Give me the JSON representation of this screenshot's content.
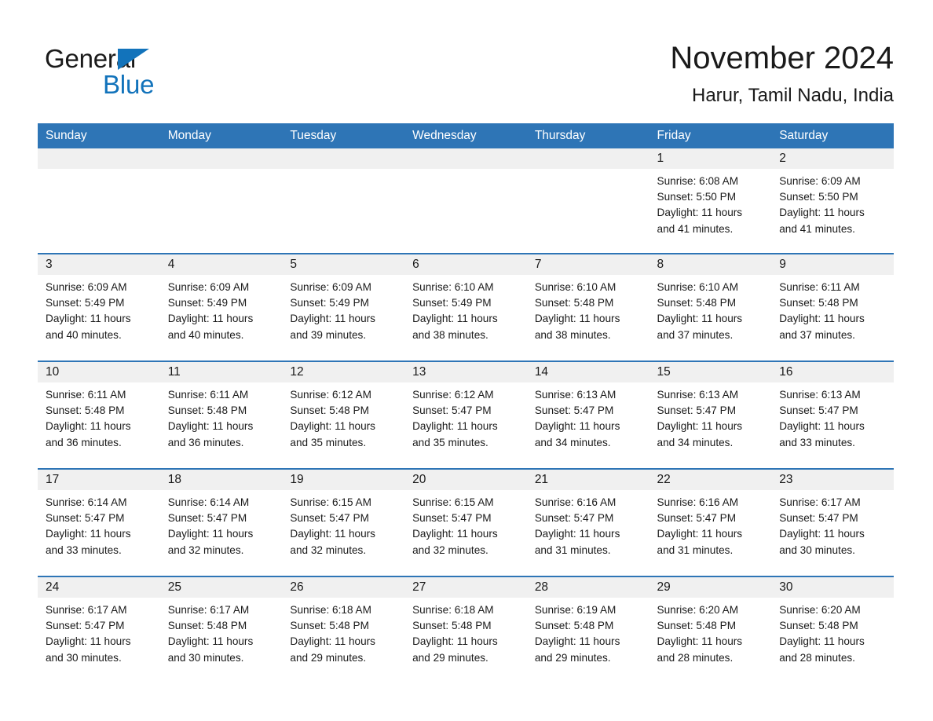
{
  "logo": {
    "word_one": "General",
    "word_two": "Blue",
    "triangle_color": "#1273bb",
    "word_two_color": "#1273bb"
  },
  "header": {
    "title": "November 2024",
    "subtitle": "Harur, Tamil Nadu, India"
  },
  "colors": {
    "header_blue": "#2e75b6",
    "day_band_gray": "#f0f0f0",
    "row_divider_blue": "#2e75b6",
    "text": "#1a1a1a"
  },
  "weekdays": [
    "Sunday",
    "Monday",
    "Tuesday",
    "Wednesday",
    "Thursday",
    "Friday",
    "Saturday"
  ],
  "weeks": [
    [
      {
        "day": "",
        "sunrise": "",
        "sunset": "",
        "daylight_line1": "",
        "daylight_line2": ""
      },
      {
        "day": "",
        "sunrise": "",
        "sunset": "",
        "daylight_line1": "",
        "daylight_line2": ""
      },
      {
        "day": "",
        "sunrise": "",
        "sunset": "",
        "daylight_line1": "",
        "daylight_line2": ""
      },
      {
        "day": "",
        "sunrise": "",
        "sunset": "",
        "daylight_line1": "",
        "daylight_line2": ""
      },
      {
        "day": "",
        "sunrise": "",
        "sunset": "",
        "daylight_line1": "",
        "daylight_line2": ""
      },
      {
        "day": "1",
        "sunrise": "Sunrise: 6:08 AM",
        "sunset": "Sunset: 5:50 PM",
        "daylight_line1": "Daylight: 11 hours",
        "daylight_line2": "and 41 minutes."
      },
      {
        "day": "2",
        "sunrise": "Sunrise: 6:09 AM",
        "sunset": "Sunset: 5:50 PM",
        "daylight_line1": "Daylight: 11 hours",
        "daylight_line2": "and 41 minutes."
      }
    ],
    [
      {
        "day": "3",
        "sunrise": "Sunrise: 6:09 AM",
        "sunset": "Sunset: 5:49 PM",
        "daylight_line1": "Daylight: 11 hours",
        "daylight_line2": "and 40 minutes."
      },
      {
        "day": "4",
        "sunrise": "Sunrise: 6:09 AM",
        "sunset": "Sunset: 5:49 PM",
        "daylight_line1": "Daylight: 11 hours",
        "daylight_line2": "and 40 minutes."
      },
      {
        "day": "5",
        "sunrise": "Sunrise: 6:09 AM",
        "sunset": "Sunset: 5:49 PM",
        "daylight_line1": "Daylight: 11 hours",
        "daylight_line2": "and 39 minutes."
      },
      {
        "day": "6",
        "sunrise": "Sunrise: 6:10 AM",
        "sunset": "Sunset: 5:49 PM",
        "daylight_line1": "Daylight: 11 hours",
        "daylight_line2": "and 38 minutes."
      },
      {
        "day": "7",
        "sunrise": "Sunrise: 6:10 AM",
        "sunset": "Sunset: 5:48 PM",
        "daylight_line1": "Daylight: 11 hours",
        "daylight_line2": "and 38 minutes."
      },
      {
        "day": "8",
        "sunrise": "Sunrise: 6:10 AM",
        "sunset": "Sunset: 5:48 PM",
        "daylight_line1": "Daylight: 11 hours",
        "daylight_line2": "and 37 minutes."
      },
      {
        "day": "9",
        "sunrise": "Sunrise: 6:11 AM",
        "sunset": "Sunset: 5:48 PM",
        "daylight_line1": "Daylight: 11 hours",
        "daylight_line2": "and 37 minutes."
      }
    ],
    [
      {
        "day": "10",
        "sunrise": "Sunrise: 6:11 AM",
        "sunset": "Sunset: 5:48 PM",
        "daylight_line1": "Daylight: 11 hours",
        "daylight_line2": "and 36 minutes."
      },
      {
        "day": "11",
        "sunrise": "Sunrise: 6:11 AM",
        "sunset": "Sunset: 5:48 PM",
        "daylight_line1": "Daylight: 11 hours",
        "daylight_line2": "and 36 minutes."
      },
      {
        "day": "12",
        "sunrise": "Sunrise: 6:12 AM",
        "sunset": "Sunset: 5:48 PM",
        "daylight_line1": "Daylight: 11 hours",
        "daylight_line2": "and 35 minutes."
      },
      {
        "day": "13",
        "sunrise": "Sunrise: 6:12 AM",
        "sunset": "Sunset: 5:47 PM",
        "daylight_line1": "Daylight: 11 hours",
        "daylight_line2": "and 35 minutes."
      },
      {
        "day": "14",
        "sunrise": "Sunrise: 6:13 AM",
        "sunset": "Sunset: 5:47 PM",
        "daylight_line1": "Daylight: 11 hours",
        "daylight_line2": "and 34 minutes."
      },
      {
        "day": "15",
        "sunrise": "Sunrise: 6:13 AM",
        "sunset": "Sunset: 5:47 PM",
        "daylight_line1": "Daylight: 11 hours",
        "daylight_line2": "and 34 minutes."
      },
      {
        "day": "16",
        "sunrise": "Sunrise: 6:13 AM",
        "sunset": "Sunset: 5:47 PM",
        "daylight_line1": "Daylight: 11 hours",
        "daylight_line2": "and 33 minutes."
      }
    ],
    [
      {
        "day": "17",
        "sunrise": "Sunrise: 6:14 AM",
        "sunset": "Sunset: 5:47 PM",
        "daylight_line1": "Daylight: 11 hours",
        "daylight_line2": "and 33 minutes."
      },
      {
        "day": "18",
        "sunrise": "Sunrise: 6:14 AM",
        "sunset": "Sunset: 5:47 PM",
        "daylight_line1": "Daylight: 11 hours",
        "daylight_line2": "and 32 minutes."
      },
      {
        "day": "19",
        "sunrise": "Sunrise: 6:15 AM",
        "sunset": "Sunset: 5:47 PM",
        "daylight_line1": "Daylight: 11 hours",
        "daylight_line2": "and 32 minutes."
      },
      {
        "day": "20",
        "sunrise": "Sunrise: 6:15 AM",
        "sunset": "Sunset: 5:47 PM",
        "daylight_line1": "Daylight: 11 hours",
        "daylight_line2": "and 32 minutes."
      },
      {
        "day": "21",
        "sunrise": "Sunrise: 6:16 AM",
        "sunset": "Sunset: 5:47 PM",
        "daylight_line1": "Daylight: 11 hours",
        "daylight_line2": "and 31 minutes."
      },
      {
        "day": "22",
        "sunrise": "Sunrise: 6:16 AM",
        "sunset": "Sunset: 5:47 PM",
        "daylight_line1": "Daylight: 11 hours",
        "daylight_line2": "and 31 minutes."
      },
      {
        "day": "23",
        "sunrise": "Sunrise: 6:17 AM",
        "sunset": "Sunset: 5:47 PM",
        "daylight_line1": "Daylight: 11 hours",
        "daylight_line2": "and 30 minutes."
      }
    ],
    [
      {
        "day": "24",
        "sunrise": "Sunrise: 6:17 AM",
        "sunset": "Sunset: 5:47 PM",
        "daylight_line1": "Daylight: 11 hours",
        "daylight_line2": "and 30 minutes."
      },
      {
        "day": "25",
        "sunrise": "Sunrise: 6:17 AM",
        "sunset": "Sunset: 5:48 PM",
        "daylight_line1": "Daylight: 11 hours",
        "daylight_line2": "and 30 minutes."
      },
      {
        "day": "26",
        "sunrise": "Sunrise: 6:18 AM",
        "sunset": "Sunset: 5:48 PM",
        "daylight_line1": "Daylight: 11 hours",
        "daylight_line2": "and 29 minutes."
      },
      {
        "day": "27",
        "sunrise": "Sunrise: 6:18 AM",
        "sunset": "Sunset: 5:48 PM",
        "daylight_line1": "Daylight: 11 hours",
        "daylight_line2": "and 29 minutes."
      },
      {
        "day": "28",
        "sunrise": "Sunrise: 6:19 AM",
        "sunset": "Sunset: 5:48 PM",
        "daylight_line1": "Daylight: 11 hours",
        "daylight_line2": "and 29 minutes."
      },
      {
        "day": "29",
        "sunrise": "Sunrise: 6:20 AM",
        "sunset": "Sunset: 5:48 PM",
        "daylight_line1": "Daylight: 11 hours",
        "daylight_line2": "and 28 minutes."
      },
      {
        "day": "30",
        "sunrise": "Sunrise: 6:20 AM",
        "sunset": "Sunset: 5:48 PM",
        "daylight_line1": "Daylight: 11 hours",
        "daylight_line2": "and 28 minutes."
      }
    ]
  ]
}
